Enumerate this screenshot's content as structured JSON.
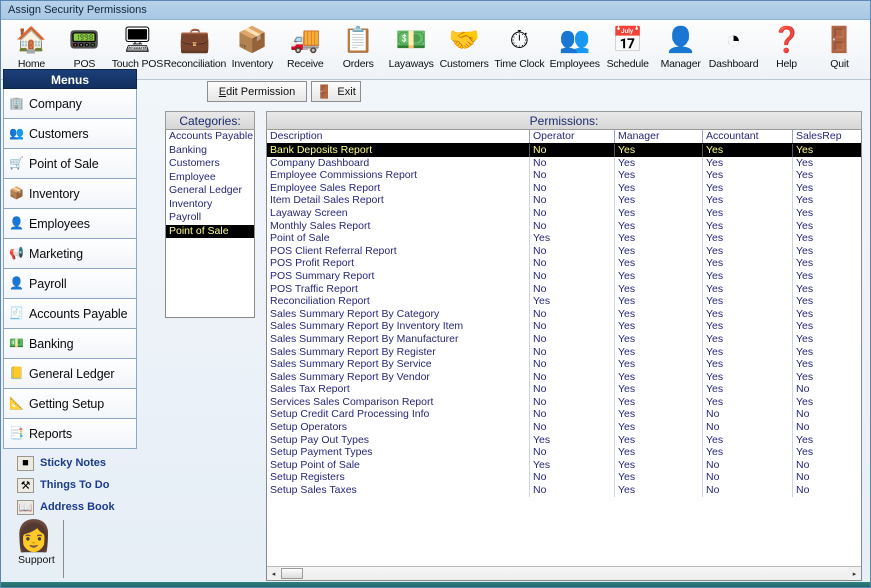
{
  "window": {
    "title": "Assign Security Permissions"
  },
  "toolbar": {
    "buttons": [
      {
        "label": "Home",
        "icon": "house-icon",
        "glyph": "🏠"
      },
      {
        "label": "POS",
        "icon": "cash-register-icon",
        "glyph": "📟"
      },
      {
        "label": "Touch POS",
        "icon": "touch-monitor-icon",
        "glyph": "🖥"
      },
      {
        "label": "Reconciliation",
        "icon": "reconcile-icon",
        "glyph": "💼"
      },
      {
        "label": "Inventory",
        "icon": "inventory-box-icon",
        "glyph": "📦"
      },
      {
        "label": "Receive",
        "icon": "forklift-icon",
        "glyph": "🚚"
      },
      {
        "label": "Orders",
        "icon": "clipboard-icon",
        "glyph": "📋"
      },
      {
        "label": "Layaways",
        "icon": "money-note-icon",
        "glyph": "💵"
      },
      {
        "label": "Customers",
        "icon": "handshake-icon",
        "glyph": "🤝"
      },
      {
        "label": "Time Clock",
        "icon": "stopwatch-icon",
        "glyph": "⏱"
      },
      {
        "label": "Employees",
        "icon": "people-icon",
        "glyph": "👥"
      },
      {
        "label": "Schedule",
        "icon": "calendar-icon",
        "glyph": "📅"
      },
      {
        "label": "Manager",
        "icon": "manager-icon",
        "glyph": "👤"
      },
      {
        "label": "Dashboard",
        "icon": "gauge-icon",
        "glyph": "◔"
      },
      {
        "label": "Help",
        "icon": "help-circle-icon",
        "glyph": "❓"
      },
      {
        "label": "Quit",
        "icon": "exit-door-icon",
        "glyph": "🚪"
      }
    ]
  },
  "sidebar": {
    "header": "Menus",
    "items": [
      {
        "label": "Company",
        "icon": "building-icon",
        "glyph": "🏢"
      },
      {
        "label": "Customers",
        "icon": "people-icon",
        "glyph": "👥"
      },
      {
        "label": "Point of Sale",
        "icon": "cart-icon",
        "glyph": "🛒"
      },
      {
        "label": "Inventory",
        "icon": "boxes-icon",
        "glyph": "📦"
      },
      {
        "label": "Employees",
        "icon": "person-icon",
        "glyph": "👤"
      },
      {
        "label": "Marketing",
        "icon": "megaphone-icon",
        "glyph": "📢"
      },
      {
        "label": "Payroll",
        "icon": "payroll-icon",
        "glyph": "👤"
      },
      {
        "label": "Accounts Payable",
        "icon": "invoice-icon",
        "glyph": "🧾"
      },
      {
        "label": "Banking",
        "icon": "banknote-icon",
        "glyph": "💵"
      },
      {
        "label": "General Ledger",
        "icon": "ledger-icon",
        "glyph": "📒"
      },
      {
        "label": "Getting Setup",
        "icon": "setup-icon",
        "glyph": "📐"
      },
      {
        "label": "Reports",
        "icon": "report-icon",
        "glyph": "📑"
      }
    ],
    "quicklinks": [
      {
        "label": "Sticky Notes",
        "icon": "sticky-note-icon",
        "glyph": "■"
      },
      {
        "label": "Things To Do",
        "icon": "hammer-icon",
        "glyph": "⚒"
      },
      {
        "label": "Address Book",
        "icon": "address-book-icon",
        "glyph": "📖"
      }
    ],
    "support": {
      "label": "Support",
      "icon": "support-agent-icon",
      "glyph": "👩"
    }
  },
  "commands": {
    "edit_permission": "Edit Permission",
    "edit_permission_accel": "E",
    "exit": "Exit",
    "exit_icon": "exit-door-icon",
    "exit_glyph": "🚪"
  },
  "categories": {
    "header": "Categories:",
    "items": [
      "Accounts Payable",
      "Banking",
      "Customers",
      "Employee",
      "General Ledger",
      "Inventory",
      "Payroll",
      "Point of Sale"
    ],
    "selected": "Point of Sale"
  },
  "permissions": {
    "header": "Permissions:",
    "columns": [
      "Description",
      "Operator",
      "Manager",
      "Accountant",
      "SalesRep"
    ],
    "selected_row": "Bank Deposits Report",
    "rows": [
      [
        "Bank Deposits Report",
        "No",
        "Yes",
        "Yes",
        "Yes"
      ],
      [
        "Company Dashboard",
        "No",
        "Yes",
        "Yes",
        "Yes"
      ],
      [
        "Employee Commissions Report",
        "No",
        "Yes",
        "Yes",
        "Yes"
      ],
      [
        "Employee Sales Report",
        "No",
        "Yes",
        "Yes",
        "Yes"
      ],
      [
        "Item Detail Sales Report",
        "No",
        "Yes",
        "Yes",
        "Yes"
      ],
      [
        "Layaway Screen",
        "No",
        "Yes",
        "Yes",
        "Yes"
      ],
      [
        "Monthly Sales Report",
        "No",
        "Yes",
        "Yes",
        "Yes"
      ],
      [
        "Point of Sale",
        "Yes",
        "Yes",
        "Yes",
        "Yes"
      ],
      [
        "POS Client Referral Report",
        "No",
        "Yes",
        "Yes",
        "Yes"
      ],
      [
        "POS Profit Report",
        "No",
        "Yes",
        "Yes",
        "Yes"
      ],
      [
        "POS Summary Report",
        "No",
        "Yes",
        "Yes",
        "Yes"
      ],
      [
        "POS Traffic Report",
        "No",
        "Yes",
        "Yes",
        "Yes"
      ],
      [
        "Reconciliation Report",
        "Yes",
        "Yes",
        "Yes",
        "Yes"
      ],
      [
        "Sales Summary Report By Category",
        "No",
        "Yes",
        "Yes",
        "Yes"
      ],
      [
        "Sales Summary Report By Inventory Item",
        "No",
        "Yes",
        "Yes",
        "Yes"
      ],
      [
        "Sales Summary Report By Manufacturer",
        "No",
        "Yes",
        "Yes",
        "Yes"
      ],
      [
        "Sales Summary Report By Register",
        "No",
        "Yes",
        "Yes",
        "Yes"
      ],
      [
        "Sales Summary Report By Service",
        "No",
        "Yes",
        "Yes",
        "Yes"
      ],
      [
        "Sales Summary Report By Vendor",
        "No",
        "Yes",
        "Yes",
        "Yes"
      ],
      [
        "Sales Tax Report",
        "No",
        "Yes",
        "Yes",
        "No"
      ],
      [
        "Services Sales Comparison Report",
        "No",
        "Yes",
        "Yes",
        "Yes"
      ],
      [
        "Setup Credit Card Processing Info",
        "No",
        "Yes",
        "No",
        "No"
      ],
      [
        "Setup Operators",
        "No",
        "Yes",
        "No",
        "No"
      ],
      [
        "Setup Pay Out Types",
        "Yes",
        "Yes",
        "Yes",
        "Yes"
      ],
      [
        "Setup Payment Types",
        "No",
        "Yes",
        "Yes",
        "Yes"
      ],
      [
        "Setup Point of Sale",
        "Yes",
        "Yes",
        "No",
        "No"
      ],
      [
        "Setup Registers",
        "No",
        "Yes",
        "No",
        "No"
      ],
      [
        "Setup Sales Taxes",
        "No",
        "Yes",
        "No",
        "No"
      ]
    ]
  },
  "scrollbar": {
    "left_arrow": "◂",
    "right_arrow": "▸"
  },
  "colors": {
    "title_bar": "#b8d2ea",
    "menu_header": "#1c3f7a",
    "list_text": "#26277a",
    "selection_bg": "#000000",
    "selection_fg": "#ffff8a",
    "status_bar": "#2f7f7f"
  }
}
